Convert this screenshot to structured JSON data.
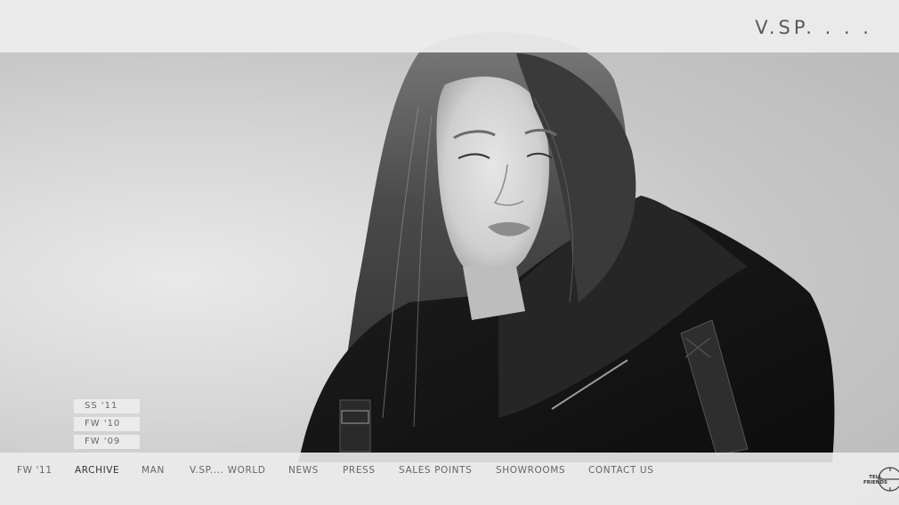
{
  "brand": {
    "logo_text": "V.SP. . . ."
  },
  "archive_menu": {
    "items": [
      {
        "label": "SS '11"
      },
      {
        "label": "FW '10"
      },
      {
        "label": "FW '09"
      }
    ]
  },
  "nav": {
    "items": [
      {
        "label": "FW '11"
      },
      {
        "label": "ARCHIVE"
      },
      {
        "label": "MAN"
      },
      {
        "label": "V.SP.... WORLD"
      },
      {
        "label": "NEWS"
      },
      {
        "label": "PRESS"
      },
      {
        "label": "SALES POINTS"
      },
      {
        "label": "SHOWROOMS"
      },
      {
        "label": "CONTACT US"
      }
    ],
    "active_index": 1
  },
  "share": {
    "line1": "TELL",
    "line2": "FRIENDS",
    "icon": "share-target-icon"
  },
  "hero": {
    "image_description_icon": "model-photo"
  }
}
